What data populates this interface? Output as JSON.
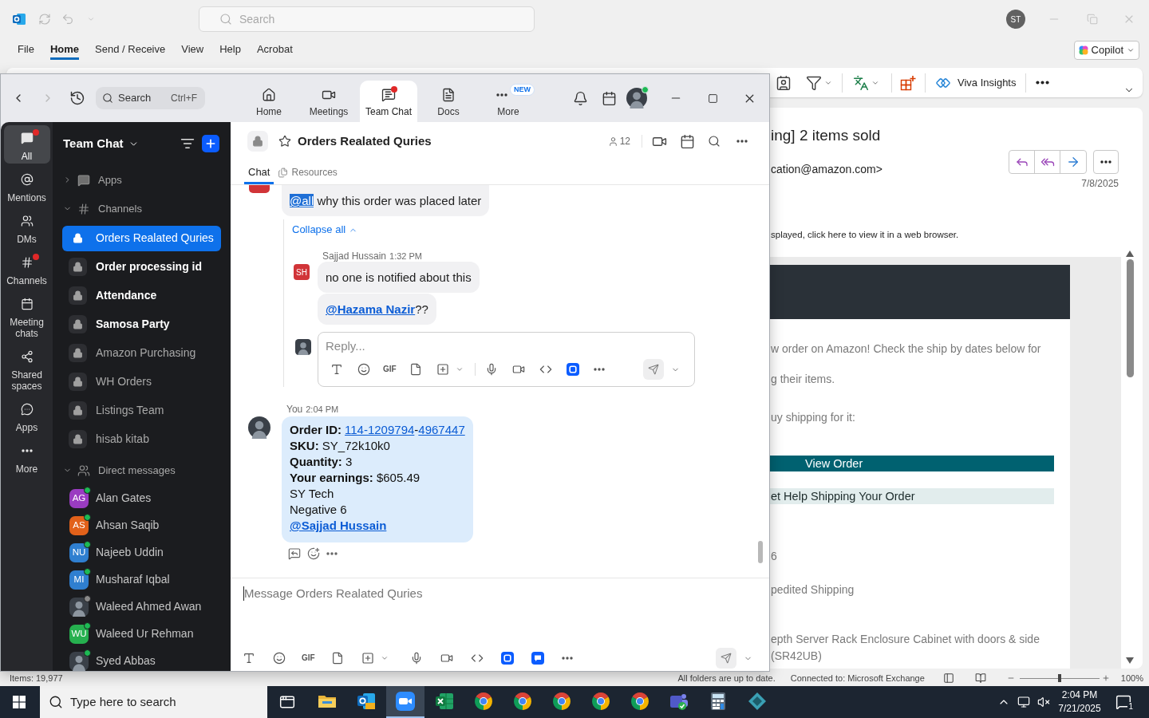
{
  "outlook": {
    "title_bar": {
      "search_placeholder": "Search",
      "account_initials": "ST"
    },
    "ribbon_tabs": [
      {
        "label": "File",
        "selected": false
      },
      {
        "label": "Home",
        "selected": true
      },
      {
        "label": "Send / Receive",
        "selected": false
      },
      {
        "label": "View",
        "selected": false
      },
      {
        "label": "Help",
        "selected": false
      },
      {
        "label": "Acrobat",
        "selected": false
      }
    ],
    "copilot_button": "Copilot",
    "toolbar": {
      "viva_insights": "Viva Insights"
    },
    "reading_pane": {
      "subject": "ing] 2 items sold",
      "sender": "cation@amazon.com>",
      "date": "7/8/2025",
      "notice": "splayed, click here to view it in a web browser.",
      "body": [
        {
          "kind": "text",
          "text": "w order on Amazon! Check the ship by dates below for"
        },
        {
          "kind": "text",
          "text": "g their items."
        },
        {
          "kind": "text",
          "text": "uy shipping for it:"
        },
        {
          "kind": "primary_button",
          "text": "View Order"
        },
        {
          "kind": "secondary_button",
          "text": "et Help Shipping Your Order"
        },
        {
          "kind": "text",
          "text": "6"
        },
        {
          "kind": "text",
          "text": "pedited Shipping"
        },
        {
          "kind": "text",
          "text": "epth Server Rack Enclosure Cabinet with doors & side"
        },
        {
          "kind": "text",
          "text": "(SR42UB)"
        }
      ]
    },
    "status_bar": {
      "items": "Items: 19,977",
      "sync": "All folders are up to date.",
      "connection": "Connected to: Microsoft Exchange",
      "zoom": {
        "level": 0.5,
        "reading": "100%"
      }
    }
  },
  "zoom_app": {
    "search": {
      "placeholder": "Search",
      "shortcut": "Ctrl+F"
    },
    "nav_tabs": [
      {
        "label": "Home",
        "selected": false,
        "dot": false
      },
      {
        "label": "Meetings",
        "selected": false,
        "dot": false
      },
      {
        "label": "Team Chat",
        "selected": true,
        "dot": true
      },
      {
        "label": "Docs",
        "selected": false,
        "dot": false
      },
      {
        "label": "More",
        "selected": false,
        "dot": false,
        "badge": "NEW"
      }
    ],
    "profile": {
      "online": true
    },
    "rail": [
      {
        "label": "All",
        "selected": true,
        "dot": true
      },
      {
        "label": "Mentions",
        "selected": false,
        "dot": false
      },
      {
        "label": "DMs",
        "selected": false,
        "dot": false
      },
      {
        "label": "Channels",
        "selected": false,
        "dot": true
      },
      {
        "label": "Meeting chats",
        "selected": false,
        "dot": false
      },
      {
        "label": "Shared spaces",
        "selected": false,
        "dot": false
      },
      {
        "label": "Apps",
        "selected": false,
        "dot": false
      },
      {
        "label": "More",
        "selected": false,
        "dot": false
      }
    ],
    "sidebar": {
      "title": "Team Chat",
      "apps": {
        "label": "Apps",
        "expanded": false
      },
      "channels": {
        "label": "Channels",
        "expanded": true,
        "items": [
          {
            "name": "Orders Realated Quries",
            "selected": true,
            "unread": false
          },
          {
            "name": "Order processing id",
            "selected": false,
            "unread": true
          },
          {
            "name": "Attendance",
            "selected": false,
            "unread": true
          },
          {
            "name": "Samosa Party",
            "selected": false,
            "unread": true
          },
          {
            "name": "Amazon Purchasing",
            "selected": false,
            "unread": false
          },
          {
            "name": "WH Orders",
            "selected": false,
            "unread": false
          },
          {
            "name": "Listings Team",
            "selected": false,
            "unread": false
          },
          {
            "name": "hisab kitab",
            "selected": false,
            "unread": false
          }
        ]
      },
      "direct_messages": {
        "label": "Direct messages",
        "expanded": true,
        "items": [
          {
            "name": "Alan Gates",
            "kind": "initials",
            "initials": "AG",
            "color": "#9a3cc1",
            "online": true
          },
          {
            "name": "Ahsan Saqib",
            "kind": "initials",
            "initials": "AS",
            "color": "#e2611a",
            "online": true
          },
          {
            "name": "Najeeb Uddin",
            "kind": "initials",
            "initials": "NU",
            "color": "#2f7fd0",
            "online": true
          },
          {
            "name": "Musharaf Iqbal",
            "kind": "initials",
            "initials": "MI",
            "color": "#2f7fd0",
            "online": true
          },
          {
            "name": "Waleed Ahmed Awan",
            "kind": "photo",
            "online": false
          },
          {
            "name": "Waleed Ur Rehman",
            "kind": "initials",
            "initials": "WU",
            "color": "#26b04f",
            "online": true
          },
          {
            "name": "Syed Abbas",
            "kind": "photo",
            "online": true
          }
        ]
      }
    },
    "chat": {
      "title": "Orders Realated Quries",
      "members": "12",
      "tabs": [
        {
          "label": "Chat",
          "selected": true
        },
        {
          "label": "Resources",
          "selected": false
        }
      ],
      "thread": {
        "root": {
          "mention": "@all",
          "text": " why this order was placed later"
        },
        "collapse": "Collapse all",
        "replies": [
          {
            "author": "Sajjad Hussain",
            "time": "1:32 PM",
            "initials": "SH",
            "color": "#d13438",
            "bubbles": [
              {
                "text": "no one is notified about this"
              },
              {
                "mention": "@Hazama Nazir",
                "text": "??"
              }
            ]
          }
        ],
        "reply_box": {
          "placeholder": "Reply...",
          "gif": "GIF"
        }
      },
      "own_message": {
        "author": "You",
        "time": "2:04 PM",
        "lines": [
          {
            "kind": "links",
            "label": "Order ID:",
            "links": [
              "114-1209794",
              "4967447"
            ],
            "separator": "-"
          },
          {
            "kind": "text",
            "text": "**SKU:** SY_72k10k0"
          },
          {
            "kind": "text",
            "text": "**Quantity:** 3"
          },
          {
            "kind": "text",
            "text": "**Your earnings:** $605.49"
          },
          {
            "kind": "text",
            "text": "SY Tech"
          },
          {
            "kind": "text",
            "text": "Negative 6"
          },
          {
            "kind": "mention",
            "text": "@Sajjad Hussain"
          }
        ]
      },
      "composer": {
        "placeholder": "Message Orders Realated Quries",
        "gif": "GIF"
      }
    }
  },
  "taskbar": {
    "search_placeholder": "Type here to search",
    "apps": [
      {
        "selected": false
      },
      {
        "selected": false
      },
      {
        "selected": true
      },
      {
        "selected": false
      },
      {
        "selected": false
      },
      {
        "selected": false
      },
      {
        "selected": false
      },
      {
        "selected": false
      },
      {
        "selected": false
      },
      {
        "selected": false
      },
      {
        "selected": false
      },
      {
        "selected": false
      }
    ],
    "time": "2:04 PM",
    "date": "7/21/2025",
    "notifications": "1"
  }
}
